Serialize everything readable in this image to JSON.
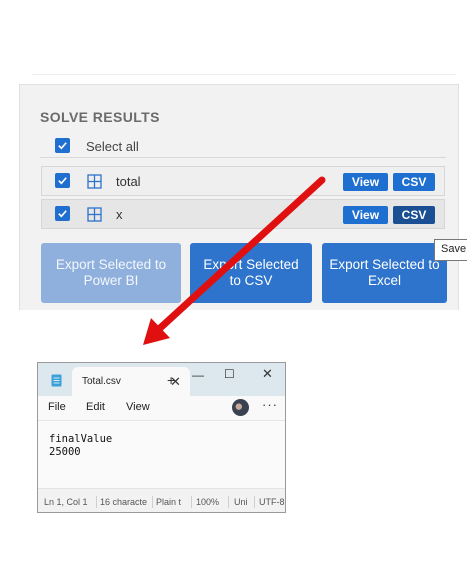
{
  "solve_results": {
    "title": "SOLVE RESULTS",
    "select_all_label": "Select all",
    "rows": [
      {
        "label": "total",
        "view": "View",
        "csv": "CSV"
      },
      {
        "label": "x",
        "view": "View",
        "csv": "CSV"
      }
    ],
    "export_power_bi": "Export Selected to Power BI",
    "export_csv": "Export Selected to CSV",
    "export_excel": "Export Selected to Excel",
    "tooltip": "Save"
  },
  "notepad": {
    "tab_title": "Total.csv",
    "menu": [
      "File",
      "Edit",
      "View"
    ],
    "content": "finalValue\n25000",
    "status": {
      "position": "Ln 1, Col 1",
      "characters": "16 characte",
      "format": "Plain t",
      "zoom": "100%",
      "line_endings": "Uni",
      "encoding": "UTF-8"
    }
  },
  "colors": {
    "accent": "#1f6fd1",
    "arrow": "#e01010"
  },
  "icons": [
    "checkbox-checked-icon",
    "table-grid-icon",
    "notepad-app-icon",
    "close-icon",
    "plus-icon",
    "minimize-icon",
    "maximize-icon",
    "more-icon"
  ]
}
